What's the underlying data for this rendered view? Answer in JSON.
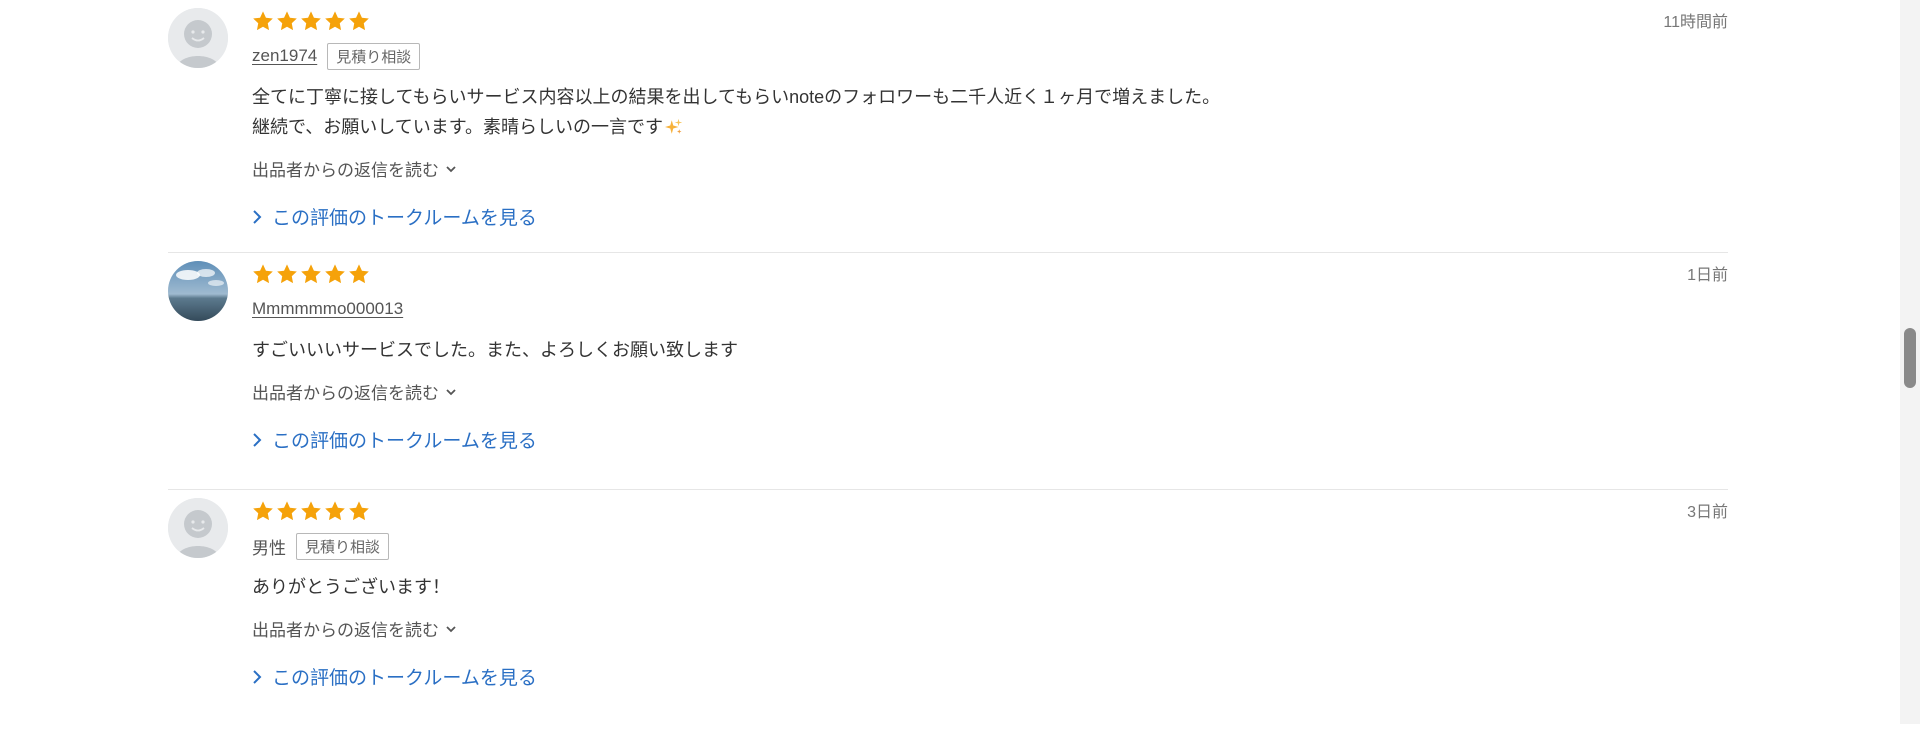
{
  "reviews": [
    {
      "rating": 5,
      "avatar": "default-face",
      "username": "zen1974",
      "badge": "見積り相談",
      "date": "11時間前",
      "comment_line1": "全てに丁寧に接してもらいサービス内容以上の結果を出してもらいnoteのフォロワーも二千人近く１ヶ月で増えました。",
      "comment_line2": "継続で、お願いしています。素晴らしいの一言です",
      "reply_label": "出品者からの返信を読む",
      "talk_label": "この評価のトークルームを見る"
    },
    {
      "rating": 5,
      "avatar": "sky-photo",
      "username": "Mmmmmmo000013",
      "date": "1日前",
      "comment": "すごいいいサービスでした。また、よろしくお願い致します",
      "reply_label": "出品者からの返信を読む",
      "talk_label": "この評価のトークルームを見る"
    },
    {
      "rating": 5,
      "avatar": "default-face",
      "username": "男性",
      "badge": "見積り相談",
      "date": "3日前",
      "comment": "ありがとうございます！",
      "reply_label": "出品者からの返信を読む",
      "talk_label": "この評価のトークルームを見る"
    }
  ],
  "colors": {
    "star": "#f5a20a",
    "link": "#2a6fc4",
    "divider": "#e6e6e6"
  }
}
